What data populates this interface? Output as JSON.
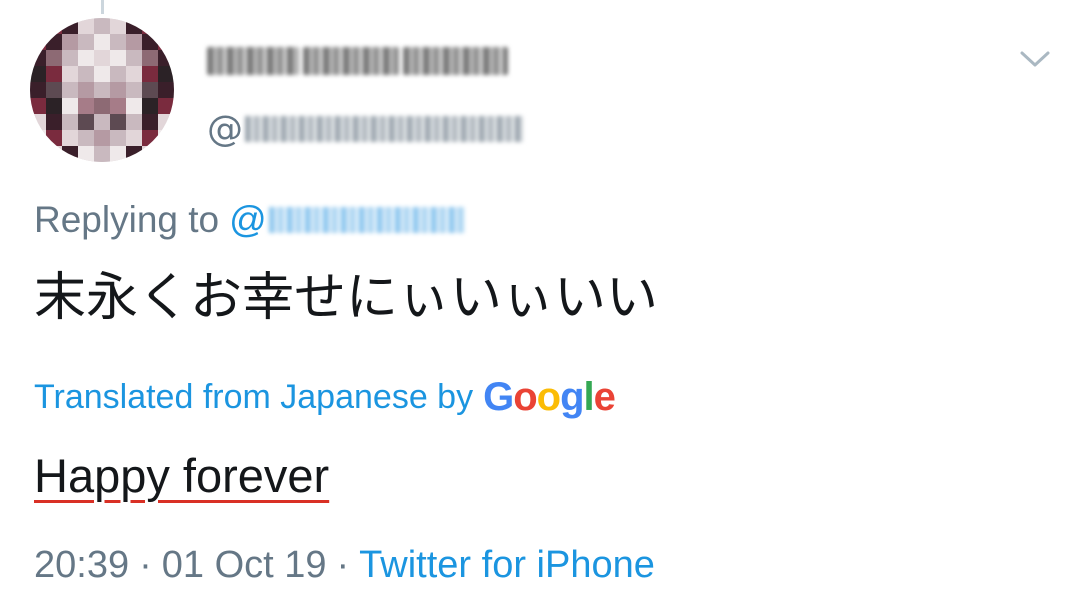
{
  "header": {
    "handle_prefix": "@"
  },
  "reply": {
    "label": "Replying to",
    "mention_prefix": "@"
  },
  "tweet": {
    "text": "末永くお幸せにぃいぃいい"
  },
  "translation": {
    "label": "Translated from Japanese by",
    "provider_letters": [
      {
        "char": "G",
        "color": "#4285f4"
      },
      {
        "char": "o",
        "color": "#ea4335"
      },
      {
        "char": "o",
        "color": "#fbbc05"
      },
      {
        "char": "g",
        "color": "#4285f4"
      },
      {
        "char": "l",
        "color": "#34a853"
      },
      {
        "char": "e",
        "color": "#ea4335"
      }
    ],
    "text": "Happy forever"
  },
  "meta": {
    "time": "20:39",
    "separator": "·",
    "date": "01 Oct 19",
    "source": "Twitter for iPhone"
  },
  "icons": {
    "more": "chevron-down-icon"
  },
  "colors": {
    "link": "#1b95e0",
    "secondary": "#657786",
    "primary_text": "#14171a",
    "spellcheck_underline": "#d93025"
  }
}
